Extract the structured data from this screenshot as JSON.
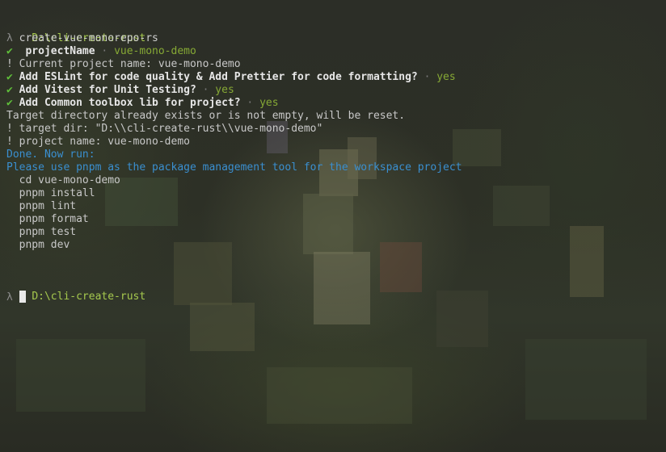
{
  "cwd": "D:\\cli-create-rust",
  "prompt_symbol": "λ",
  "command": "create-vue-monorepo-rs",
  "check_icon": "✔",
  "separator": "·",
  "project_name_prompt": {
    "question": "projectName",
    "answer": "vue-mono-demo"
  },
  "current_project_line": "! Current project name: vue-mono-demo",
  "questions": [
    {
      "text": "Add ESLint for code quality & Add Prettier for code formatting?",
      "answer": "yes"
    },
    {
      "text": "Add Vitest for Unit Testing?",
      "answer": "yes"
    },
    {
      "text": "Add Common toolbox lib for project?",
      "answer": "yes"
    }
  ],
  "messages": [
    "Target directory already exists or is not empty, will be reset.",
    "! target dir: \"D:\\\\cli-create-rust\\\\vue-mono-demo\"",
    "! project name: vue-mono-demo"
  ],
  "done_line": "Done. Now run:",
  "pnpm_hint": "Please use pnpm as the package management tool for the workspace project",
  "next_steps": [
    "cd vue-mono-demo",
    "pnpm install",
    "pnpm lint",
    "pnpm format",
    "pnpm test",
    "pnpm dev"
  ],
  "colors": {
    "path": "#a6c94e",
    "check": "#5fbf3a",
    "answer": "#86a935",
    "info": "#3a8fd0",
    "background": "#2b2d25"
  }
}
